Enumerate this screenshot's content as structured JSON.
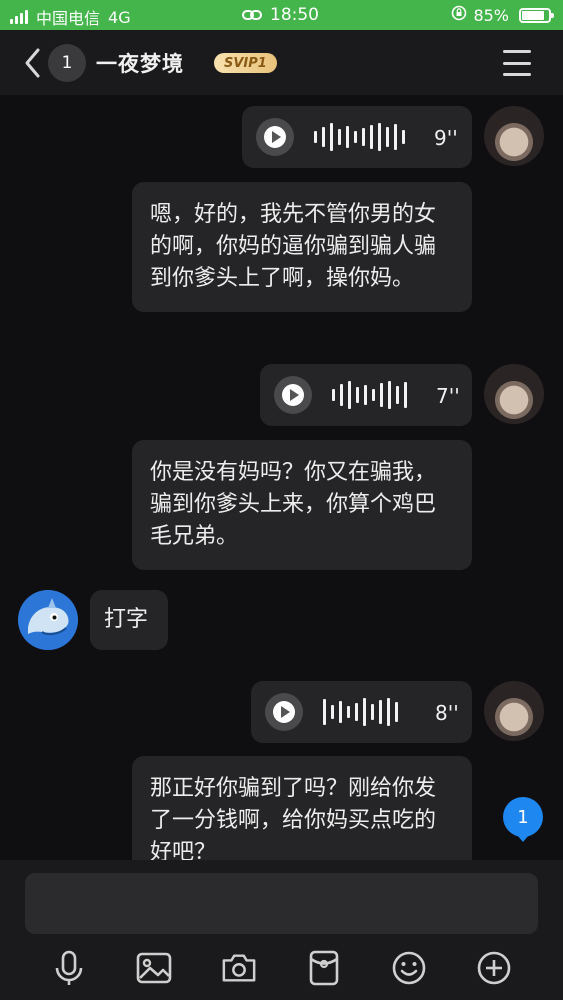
{
  "status_bar": {
    "carrier": "中国电信",
    "network": "4G",
    "time": "18:50",
    "battery": "85%",
    "battery_level": 0.85
  },
  "header": {
    "unread_count": "1",
    "title": "一夜梦境",
    "badge": "SVIP1"
  },
  "messages": [
    {
      "sender": "self",
      "type": "voice",
      "duration": "9''"
    },
    {
      "sender": "self",
      "type": "text",
      "text": "嗯，好的，我先不管你男的女的啊，你妈的逼你骗到骗人骗到你爹头上了啊，操你妈。"
    },
    {
      "sender": "self",
      "type": "voice",
      "duration": "7''"
    },
    {
      "sender": "self",
      "type": "text",
      "text": "你是没有妈吗？你又在骗我，骗到你爹头上来，你算个鸡巴毛兄弟。"
    },
    {
      "sender": "other",
      "type": "text",
      "text": "打字"
    },
    {
      "sender": "self",
      "type": "voice",
      "duration": "8''"
    },
    {
      "sender": "self",
      "type": "text",
      "text": "那正好你骗到了吗？刚给你发了一分钱啊，给你妈买点吃的好吧？"
    }
  ],
  "new_message_badge": "1",
  "input": {
    "placeholder": ""
  },
  "toolbar": [
    "mic-icon",
    "image-icon",
    "camera-icon",
    "red-packet-icon",
    "emoji-icon",
    "plus-icon"
  ],
  "colors": {
    "status_bar": "#43b54a",
    "background": "#0f0f11",
    "bubble": "#252527",
    "accent": "#1e88f0",
    "svip": "#e8c27a"
  }
}
